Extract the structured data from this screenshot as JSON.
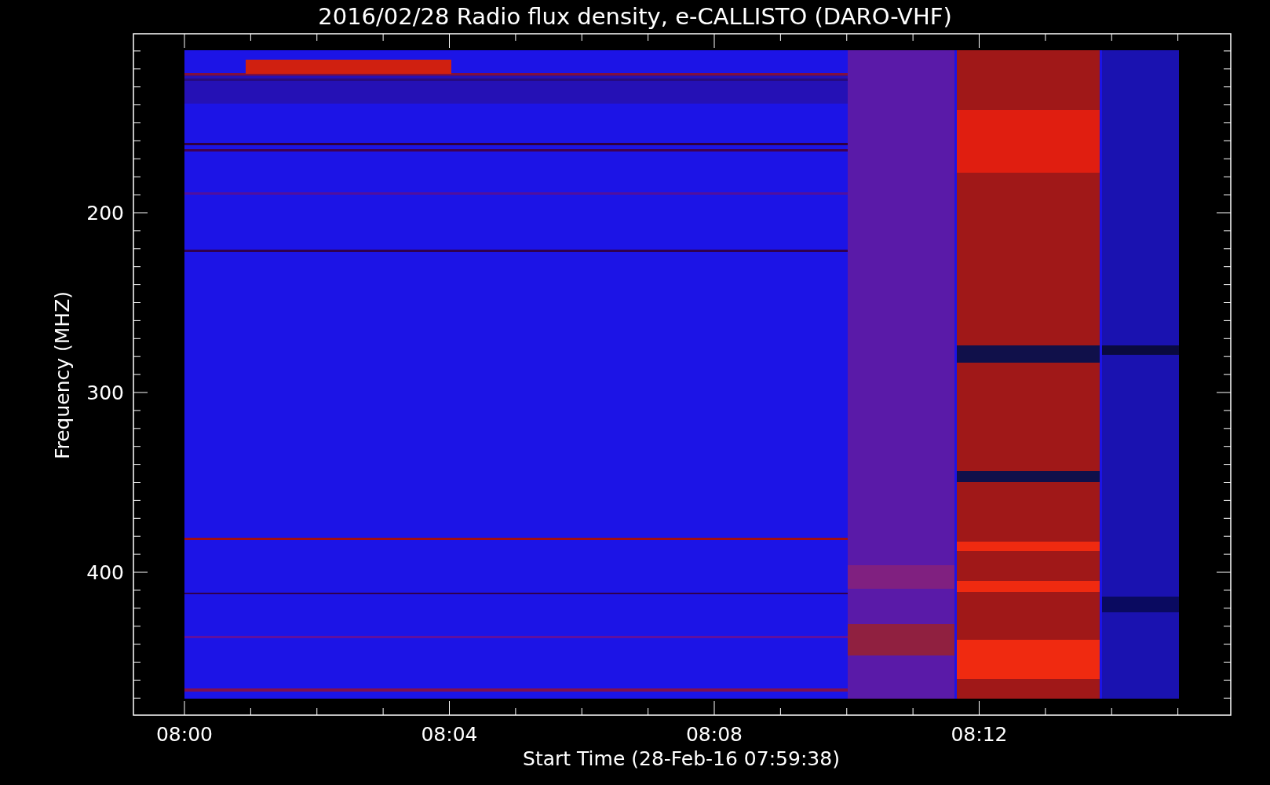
{
  "title": "2016/02/28  Radio flux density, e-CALLISTO (DARO-VHF)",
  "y_axis": {
    "label": "Frequency (MHZ)",
    "ticks": [
      "200",
      "300",
      "400"
    ]
  },
  "x_axis": {
    "label": "Start Time (28-Feb-16 07:59:38)",
    "ticks": [
      "08:00",
      "08:04",
      "08:08",
      "08:12"
    ]
  }
}
